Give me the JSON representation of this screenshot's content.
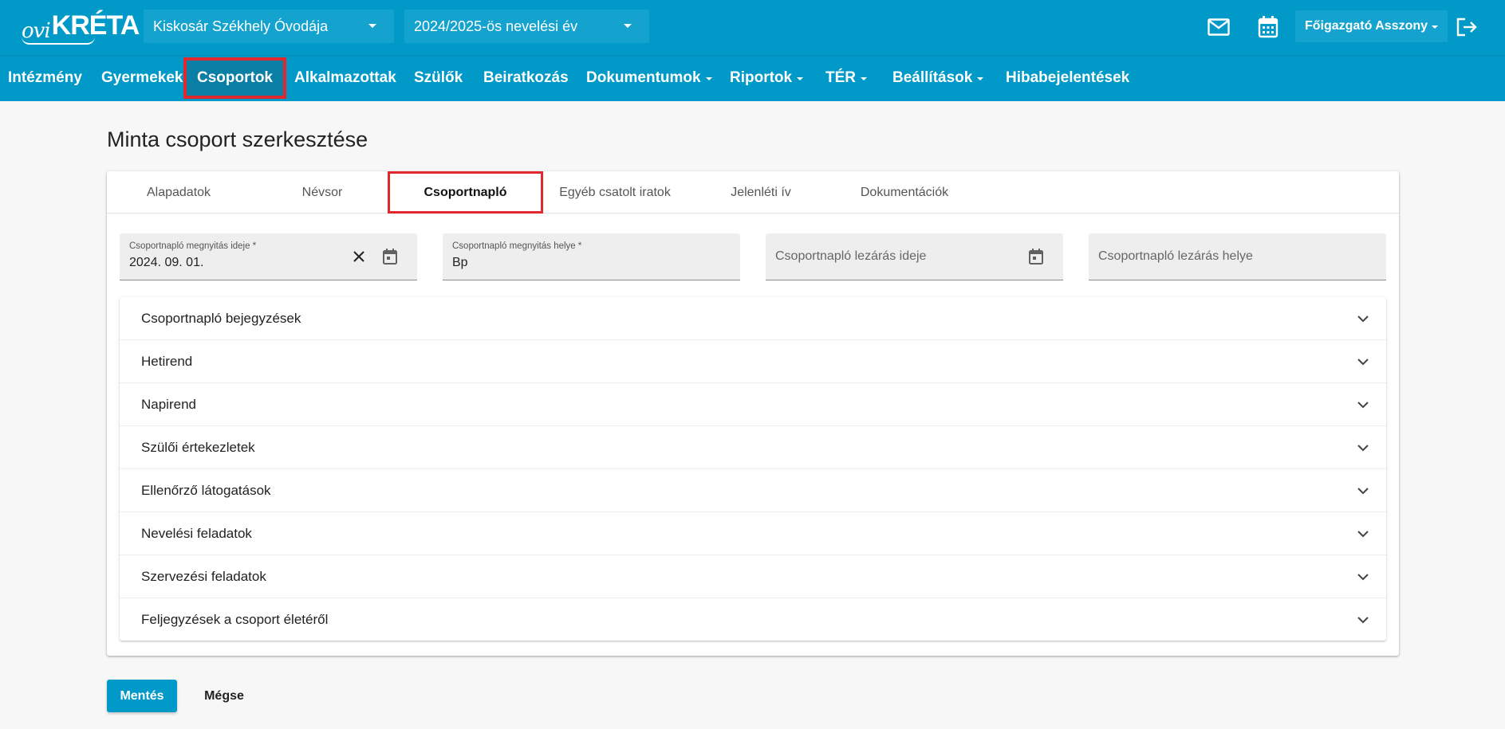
{
  "header": {
    "logo_text_1": "ovi",
    "logo_text_2": "KRÉTA",
    "institution_select": "Kiskosár Székhely Óvodája",
    "year_select": "2024/2025-ös nevelési év",
    "user_menu": "Főigazgató Asszony",
    "icons": [
      "mail-icon",
      "calendar-icon",
      "logout-icon"
    ]
  },
  "nav": {
    "items": [
      {
        "label": "Intézmény",
        "dropdown": false
      },
      {
        "label": "Gyermekek",
        "dropdown": false
      },
      {
        "label": "Csoportok",
        "dropdown": false,
        "active": true
      },
      {
        "label": "Alkalmazottak",
        "dropdown": false
      },
      {
        "label": "Szülők",
        "dropdown": false
      },
      {
        "label": "Beiratkozás",
        "dropdown": false
      },
      {
        "label": "Dokumentumok",
        "dropdown": true
      },
      {
        "label": "Riportok",
        "dropdown": true
      },
      {
        "label": "TÉR",
        "dropdown": true
      },
      {
        "label": "Beállítások",
        "dropdown": true
      },
      {
        "label": "Hibabejelentések",
        "dropdown": false
      }
    ]
  },
  "page": {
    "title": "Minta csoport szerkesztése"
  },
  "tabs": [
    {
      "label": "Alapadatok"
    },
    {
      "label": "Névsor"
    },
    {
      "label": "Csoportnapló",
      "active": true
    },
    {
      "label": "Egyéb csatolt iratok"
    },
    {
      "label": "Jelenléti ív"
    },
    {
      "label": "Dokumentációk"
    }
  ],
  "fields": {
    "opening_date": {
      "label": "Csoportnapló megnyitás ideje *",
      "value": "2024. 09. 01."
    },
    "opening_place": {
      "label": "Csoportnapló megnyitás helye *",
      "value": "Bp"
    },
    "closing_date": {
      "placeholder": "Csoportnapló lezárás ideje"
    },
    "closing_place": {
      "placeholder": "Csoportnapló lezárás helye"
    }
  },
  "sections": [
    "Csoportnapló bejegyzések",
    "Hetirend",
    "Napirend",
    "Szülői értekezletek",
    "Ellenőrző látogatások",
    "Nevelési feladatok",
    "Szervezési feladatok",
    "Feljegyzések a csoport életéről"
  ],
  "actions": {
    "save": "Mentés",
    "cancel": "Mégse"
  },
  "colors": {
    "brand": "#0099c8",
    "highlight": "#e0282f"
  }
}
